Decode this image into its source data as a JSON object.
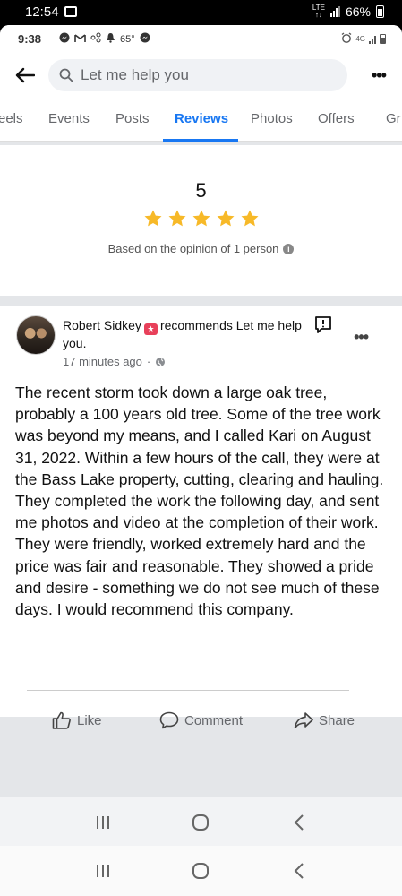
{
  "outer_status": {
    "time": "12:54",
    "battery": "66%"
  },
  "inner_status": {
    "time": "9:38",
    "temp": "65°"
  },
  "search": {
    "placeholder": "Let me help you"
  },
  "tabs": [
    {
      "label": "eels"
    },
    {
      "label": "Events"
    },
    {
      "label": "Posts"
    },
    {
      "label": "Reviews",
      "active": true
    },
    {
      "label": "Photos"
    },
    {
      "label": "Offers"
    },
    {
      "label": "Gr"
    }
  ],
  "rating": {
    "score": "5",
    "stars": 5,
    "basis": "Based on the opinion of 1 person"
  },
  "review": {
    "author": "Robert Sidkey",
    "recommends_text": "recommends Let me help you.",
    "time": "17 minutes ago",
    "body": "The recent storm took down a large oak tree, probably a 100 years old tree. Some of the tree work was beyond my means, and I called Kari on August 31, 2022. Within a few hours of the call, they were at the Bass Lake property, cutting, clearing and hauling. They completed the work the following day, and sent me photos and video at the completion of their work. They were friendly, worked extremely hard and the price was fair and reasonable. They showed a pride and desire - something we do not see much of these days. I would recommend this company.",
    "actions": {
      "like": "Like",
      "comment": "Comment",
      "share": "Share"
    }
  },
  "colors": {
    "accent": "#1877f2",
    "star": "#f7b928",
    "badge": "#e8405a"
  }
}
